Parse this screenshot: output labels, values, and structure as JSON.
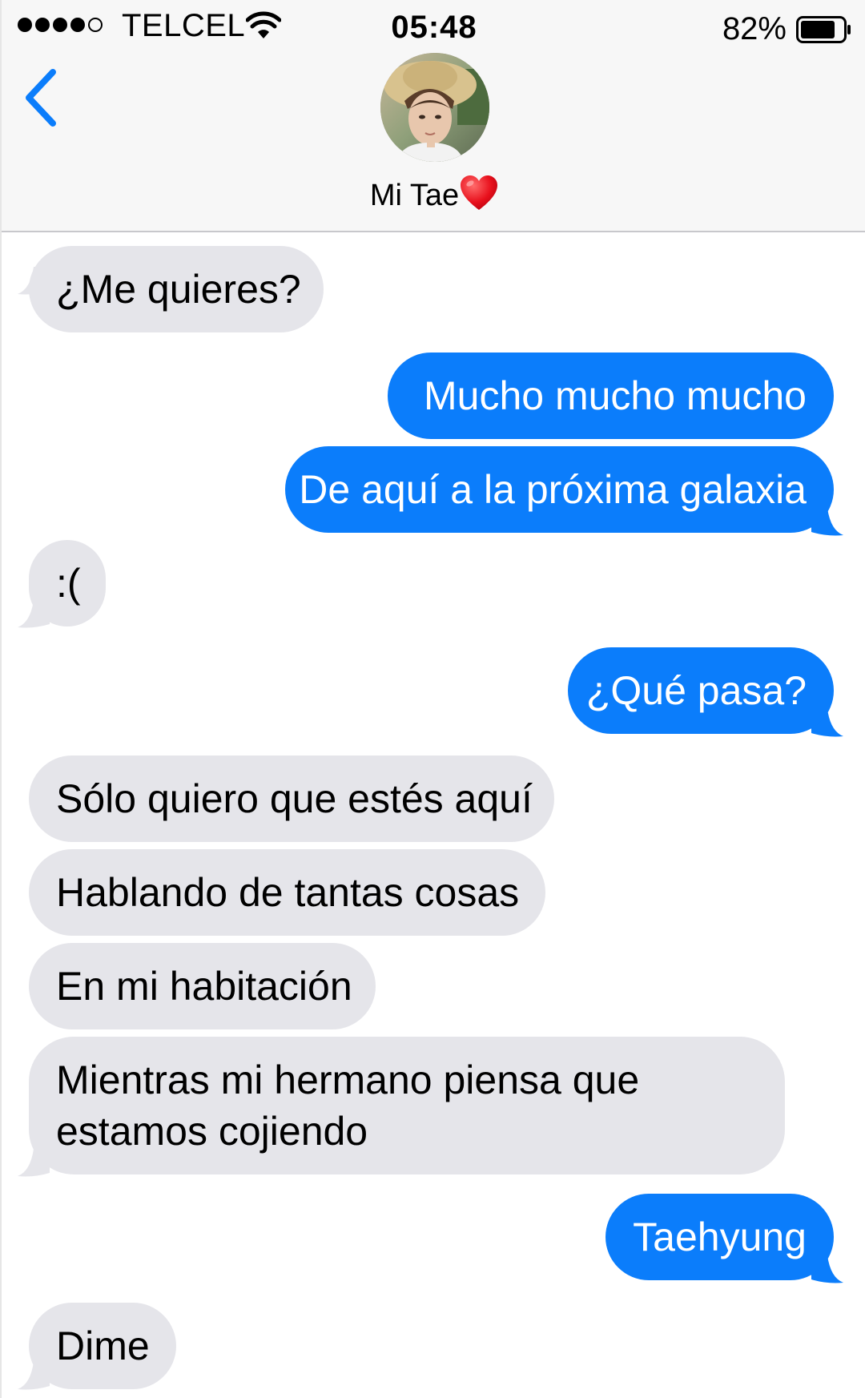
{
  "status_bar": {
    "carrier": "TELCEL",
    "time": "05:48",
    "battery_percent": "82%",
    "battery_level": 0.82,
    "signal_bars_filled": 4,
    "signal_bars_total": 5
  },
  "header": {
    "contact_name": "Mi Tae",
    "back_icon": "chevron-left-icon",
    "name_emoji": "red-heart-icon"
  },
  "colors": {
    "accent": "#0b7dfb",
    "incoming_bubble": "#e5e5ea",
    "header_bg": "#f7f7f7"
  },
  "messages": [
    {
      "direction": "incoming",
      "text": "¿Me quieres?"
    },
    {
      "direction": "outgoing",
      "text": "Mucho mucho mucho"
    },
    {
      "direction": "outgoing",
      "text": "De aquí a la próxima galaxia"
    },
    {
      "direction": "incoming",
      "text": ":("
    },
    {
      "direction": "outgoing",
      "text": "¿Qué pasa?"
    },
    {
      "direction": "incoming",
      "text": "Sólo quiero que estés aquí"
    },
    {
      "direction": "incoming",
      "text": "Hablando de tantas cosas"
    },
    {
      "direction": "incoming",
      "text": "En mi habitación"
    },
    {
      "direction": "incoming",
      "lines": [
        "Mientras mi hermano piensa que",
        "estamos cojiendo"
      ]
    },
    {
      "direction": "outgoing",
      "text": "Taehyung"
    },
    {
      "direction": "incoming",
      "text": "Dime"
    }
  ]
}
